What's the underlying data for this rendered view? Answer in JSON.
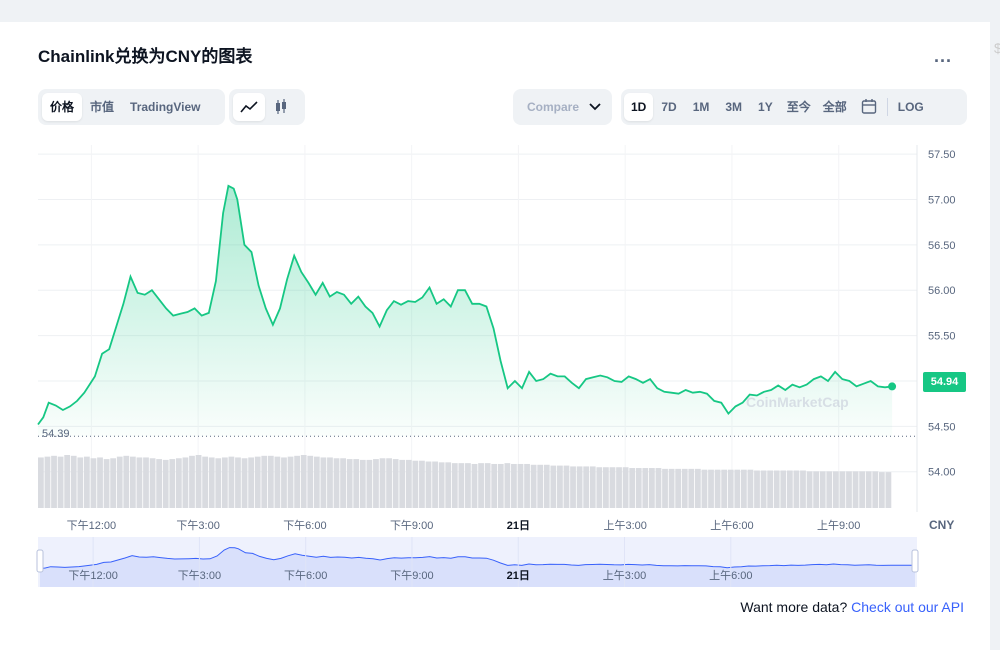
{
  "title": "Chainlink兑换为CNY的图表",
  "menu_dots": "...",
  "view_tabs": [
    {
      "label": "价格",
      "active": true
    },
    {
      "label": "市值",
      "active": false
    },
    {
      "label": "TradingView",
      "active": false
    }
  ],
  "chart_type_buttons": [
    {
      "icon": "line-chart-icon",
      "active": true
    },
    {
      "icon": "candlestick-icon",
      "active": false
    }
  ],
  "compare": {
    "label": "Compare"
  },
  "range_tabs": [
    {
      "label": "1D",
      "active": true
    },
    {
      "label": "7D",
      "active": false
    },
    {
      "label": "1M",
      "active": false
    },
    {
      "label": "3M",
      "active": false
    },
    {
      "label": "1Y",
      "active": false
    },
    {
      "label": "至今",
      "active": false
    },
    {
      "label": "全部",
      "active": false
    }
  ],
  "calendar_icon": "calendar-icon",
  "log_label": "LOG",
  "watermark": "CoinMarketCap",
  "currency_label": "CNY",
  "footer": {
    "text": "Want more data? ",
    "link": "Check out our API"
  },
  "colors": {
    "line": "#16c784",
    "volume": "#d9dbe0",
    "navigator_line": "#3861fb",
    "navigator_fill": "#e3e8fb"
  },
  "chart_data": {
    "type": "area",
    "title": "Chainlink兑换为CNY的图表",
    "ylim": [
      53.6,
      57.6
    ],
    "yticks": [
      54.0,
      54.5,
      55.0,
      55.5,
      56.0,
      56.5,
      57.0,
      57.5
    ],
    "ytick_labels": [
      "54.00",
      "54.50",
      "55.00",
      "55.50",
      "56.00",
      "56.50",
      "57.00",
      "57.50"
    ],
    "x_range": [
      0,
      24.7
    ],
    "x_ticks": [
      {
        "x": 1.5,
        "label": "下午12:00"
      },
      {
        "x": 4.5,
        "label": "下午3:00"
      },
      {
        "x": 7.5,
        "label": "下午6:00"
      },
      {
        "x": 10.5,
        "label": "下午9:00"
      },
      {
        "x": 13.5,
        "label": "21日"
      },
      {
        "x": 16.5,
        "label": "上午3:00"
      },
      {
        "x": 19.5,
        "label": "上午6:00"
      },
      {
        "x": 22.5,
        "label": "上午9:00"
      }
    ],
    "current_price": "54.94",
    "min_price_label": "54.39",
    "min_price": 54.39,
    "series": [
      {
        "x": [
          0.0,
          0.15,
          0.3,
          0.5,
          0.7,
          0.9,
          1.1,
          1.3,
          1.6,
          1.8,
          2.0,
          2.2,
          2.4,
          2.6,
          2.8,
          3.0,
          3.2,
          3.4,
          3.6,
          3.8,
          4.0,
          4.2,
          4.4,
          4.6,
          4.8,
          5.0,
          5.2,
          5.35,
          5.5,
          5.6,
          5.8,
          6.0,
          6.2,
          6.4,
          6.6,
          6.8,
          7.0,
          7.2,
          7.4,
          7.6,
          7.8,
          8.0,
          8.2,
          8.4,
          8.6,
          8.8,
          9.0,
          9.2,
          9.4,
          9.6,
          9.8,
          10.0,
          10.2,
          10.4,
          10.6,
          10.8,
          11.0,
          11.2,
          11.4,
          11.6,
          11.8,
          12.0,
          12.2,
          12.4,
          12.6,
          12.8,
          13.0,
          13.2,
          13.4,
          13.6,
          13.8,
          14.0,
          14.2,
          14.4,
          14.6,
          14.8,
          15.0,
          15.2,
          15.4,
          15.6,
          15.8,
          16.0,
          16.2,
          16.4,
          16.6,
          16.8,
          17.0,
          17.2,
          17.4,
          17.6,
          17.8,
          18.0,
          18.2,
          18.4,
          18.6,
          18.8,
          19.0,
          19.2,
          19.4,
          19.6,
          19.8,
          20.0,
          20.2,
          20.4,
          20.6,
          20.8,
          21.0,
          21.2,
          21.4,
          21.6,
          21.8,
          22.0,
          22.2,
          22.4,
          22.6,
          22.8,
          23.0,
          23.2,
          23.4,
          23.6,
          23.8,
          24.0
        ],
        "values": [
          54.52,
          54.6,
          54.76,
          54.73,
          54.68,
          54.72,
          54.78,
          54.87,
          55.05,
          55.3,
          55.35,
          55.6,
          55.85,
          56.15,
          55.97,
          55.95,
          56.0,
          55.9,
          55.8,
          55.72,
          55.74,
          55.76,
          55.8,
          55.72,
          55.75,
          56.1,
          56.85,
          57.15,
          57.12,
          57.0,
          56.5,
          56.42,
          56.05,
          55.8,
          55.62,
          55.8,
          56.12,
          56.38,
          56.2,
          56.08,
          55.95,
          56.08,
          55.93,
          55.98,
          55.95,
          55.85,
          55.93,
          55.82,
          55.75,
          55.6,
          55.78,
          55.88,
          55.84,
          55.88,
          55.87,
          55.92,
          56.03,
          55.85,
          55.9,
          55.82,
          56.0,
          56.0,
          55.85,
          55.85,
          55.82,
          55.58,
          55.22,
          54.92,
          55.0,
          54.92,
          55.1,
          55.0,
          55.02,
          55.08,
          55.05,
          55.05,
          54.98,
          54.92,
          55.02,
          55.04,
          55.06,
          55.04,
          55.0,
          54.99,
          55.05,
          55.02,
          54.98,
          55.02,
          54.92,
          54.88,
          54.87,
          54.86,
          54.9,
          54.87,
          54.88,
          54.86,
          54.78,
          54.76,
          54.64,
          54.72,
          54.76,
          54.85,
          54.84,
          54.88,
          54.9,
          54.95,
          54.9,
          54.96,
          54.93,
          54.96,
          55.02,
          55.05,
          55.0,
          55.1,
          55.02,
          55.0,
          54.94,
          54.97,
          55.0,
          54.94,
          54.93,
          54.94
        ]
      }
    ],
    "volume": [
      62,
      63,
      64,
      63,
      65,
      64,
      62,
      63,
      61,
      62,
      60,
      61,
      63,
      64,
      63,
      62,
      62,
      61,
      60,
      59,
      60,
      61,
      62,
      64,
      65,
      63,
      62,
      61,
      62,
      63,
      62,
      61,
      62,
      63,
      64,
      64,
      63,
      62,
      63,
      64,
      65,
      64,
      63,
      62,
      62,
      61,
      61,
      60,
      60,
      59,
      59,
      60,
      61,
      61,
      60,
      59,
      59,
      58,
      58,
      57,
      57,
      56,
      56,
      55,
      55,
      55,
      54,
      55,
      55,
      54,
      54,
      55,
      54,
      54,
      54,
      53,
      53,
      53,
      52,
      52,
      52,
      51,
      51,
      51,
      51,
      50,
      50,
      50,
      50,
      50,
      49,
      49,
      49,
      49,
      49,
      48,
      48,
      48,
      48,
      48,
      48,
      47,
      47,
      47,
      47,
      47,
      47,
      47,
      47,
      46,
      46,
      46,
      46,
      46,
      46,
      46,
      46,
      45,
      45,
      45,
      45,
      45,
      45,
      45,
      45,
      45,
      45,
      45,
      44,
      44
    ]
  },
  "navigator": {
    "x_ticks": [
      {
        "x": 1.5,
        "label": "下午12:00"
      },
      {
        "x": 4.5,
        "label": "下午3:00"
      },
      {
        "x": 7.5,
        "label": "下午6:00"
      },
      {
        "x": 10.5,
        "label": "下午9:00"
      },
      {
        "x": 13.5,
        "label": "21日"
      },
      {
        "x": 16.5,
        "label": "上午3:00"
      },
      {
        "x": 19.5,
        "label": "上午6:00"
      }
    ]
  }
}
